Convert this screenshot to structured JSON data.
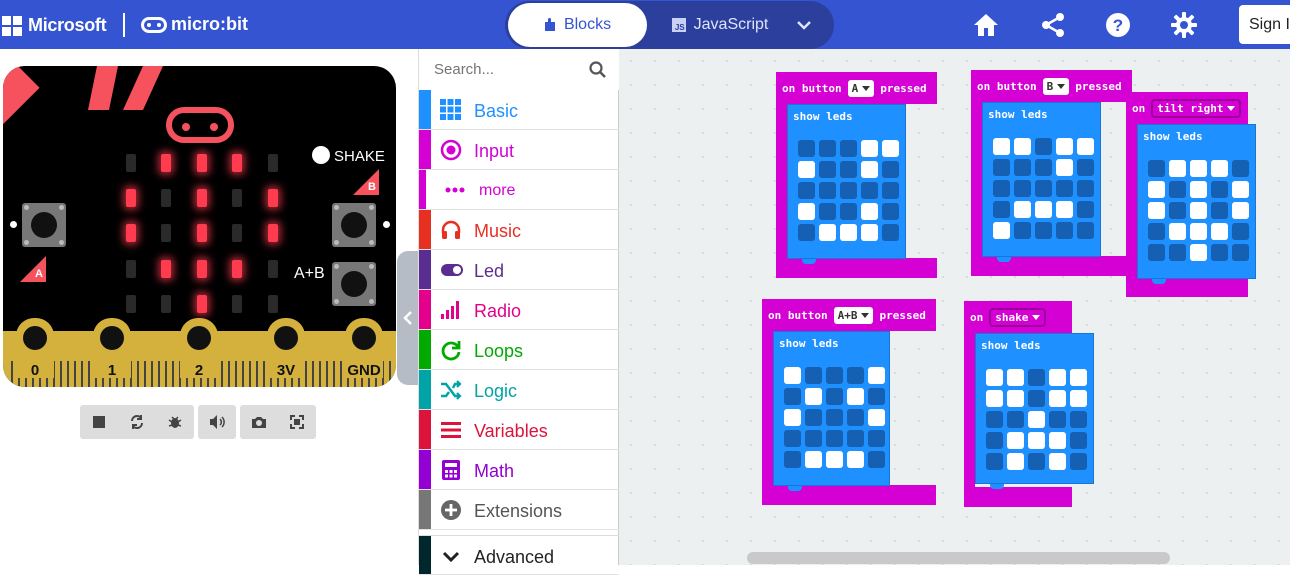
{
  "header": {
    "brand": "Microsoft",
    "product": "micro:bit",
    "tabs": [
      {
        "label": "Blocks",
        "active": true
      },
      {
        "label": "JavaScript",
        "active": false
      }
    ],
    "js_badge": "JS",
    "icons": [
      "home-icon",
      "share-icon",
      "help-icon",
      "settings-icon"
    ],
    "sign_in": "Sign In",
    "colors": {
      "bar": "#3454D1",
      "toggle": "#2c3f9d"
    }
  },
  "simulator": {
    "shake_label": "SHAKE",
    "ab_label": "A+B",
    "button_a": "A",
    "button_b": "B",
    "pins": [
      "0",
      "1",
      "2",
      "3V",
      "GND"
    ],
    "led_matrix": [
      [
        0,
        1,
        1,
        1,
        0
      ],
      [
        1,
        0,
        1,
        0,
        1
      ],
      [
        1,
        0,
        1,
        0,
        1
      ],
      [
        0,
        1,
        1,
        1,
        0
      ],
      [
        0,
        0,
        1,
        0,
        0
      ]
    ],
    "toolbar_icons": [
      "stop-icon",
      "restart-icon",
      "debug-icon",
      "mute-icon",
      "screenshot-icon",
      "fullscreen-icon"
    ]
  },
  "toolbox": {
    "search_placeholder": "Search...",
    "categories": [
      {
        "label": "Basic",
        "color": "#1e90ff",
        "icon": "grid-icon"
      },
      {
        "label": "Input",
        "color": "#d400d4",
        "icon": "target-icon"
      },
      {
        "label": "more",
        "color": "#d400d4",
        "icon": "dots-icon"
      },
      {
        "label": "Music",
        "color": "#e63022",
        "icon": "headphones-icon"
      },
      {
        "label": "Led",
        "color": "#5c2d91",
        "icon": "toggle-icon"
      },
      {
        "label": "Radio",
        "color": "#e3008c",
        "icon": "signal-icon"
      },
      {
        "label": "Loops",
        "color": "#00aa00",
        "icon": "refresh-icon"
      },
      {
        "label": "Logic",
        "color": "#00a4a6",
        "icon": "shuffle-icon"
      },
      {
        "label": "Variables",
        "color": "#dc143c",
        "icon": "list-icon"
      },
      {
        "label": "Math",
        "color": "#9400d3",
        "icon": "calculator-icon"
      },
      {
        "label": "Extensions",
        "color": "#777777",
        "icon": "plus-circle-icon"
      },
      {
        "label": "Advanced",
        "color": "#00272b",
        "icon": "chevron-down-icon"
      }
    ]
  },
  "workspace": {
    "show_leds": "show leds",
    "blocks": [
      {
        "prefix": "on button",
        "option": "A",
        "suffix": "pressed",
        "leds": [
          [
            0,
            0,
            0,
            1,
            1
          ],
          [
            1,
            0,
            0,
            1,
            0
          ],
          [
            0,
            0,
            0,
            0,
            0
          ],
          [
            1,
            0,
            0,
            1,
            0
          ],
          [
            0,
            1,
            1,
            1,
            0
          ]
        ]
      },
      {
        "prefix": "on button",
        "option": "B",
        "suffix": "pressed",
        "leds": [
          [
            1,
            1,
            0,
            1,
            1
          ],
          [
            0,
            0,
            0,
            1,
            0
          ],
          [
            0,
            0,
            0,
            0,
            0
          ],
          [
            0,
            1,
            1,
            1,
            0
          ],
          [
            1,
            0,
            0,
            0,
            0
          ]
        ]
      },
      {
        "prefix": "on",
        "option": "tilt right",
        "suffix": "",
        "leds": [
          [
            0,
            1,
            1,
            1,
            0
          ],
          [
            1,
            0,
            1,
            0,
            1
          ],
          [
            1,
            0,
            1,
            0,
            1
          ],
          [
            0,
            1,
            1,
            1,
            0
          ],
          [
            0,
            0,
            1,
            0,
            0
          ]
        ]
      },
      {
        "prefix": "on button",
        "option": "A+B",
        "suffix": "pressed",
        "leds": [
          [
            1,
            0,
            0,
            0,
            1
          ],
          [
            0,
            1,
            0,
            1,
            0
          ],
          [
            1,
            0,
            0,
            0,
            1
          ],
          [
            0,
            0,
            0,
            0,
            0
          ],
          [
            0,
            1,
            1,
            1,
            0
          ]
        ]
      },
      {
        "prefix": "on",
        "option": "shake",
        "suffix": "",
        "leds": [
          [
            1,
            1,
            0,
            1,
            1
          ],
          [
            1,
            1,
            0,
            1,
            1
          ],
          [
            0,
            0,
            1,
            0,
            0
          ],
          [
            0,
            1,
            1,
            1,
            0
          ],
          [
            0,
            1,
            0,
            1,
            0
          ]
        ]
      }
    ],
    "colors": {
      "event": "#d400d4",
      "basic": "#1e90ff",
      "led_off": "#1660b3",
      "led_on": "#ffffff"
    }
  }
}
